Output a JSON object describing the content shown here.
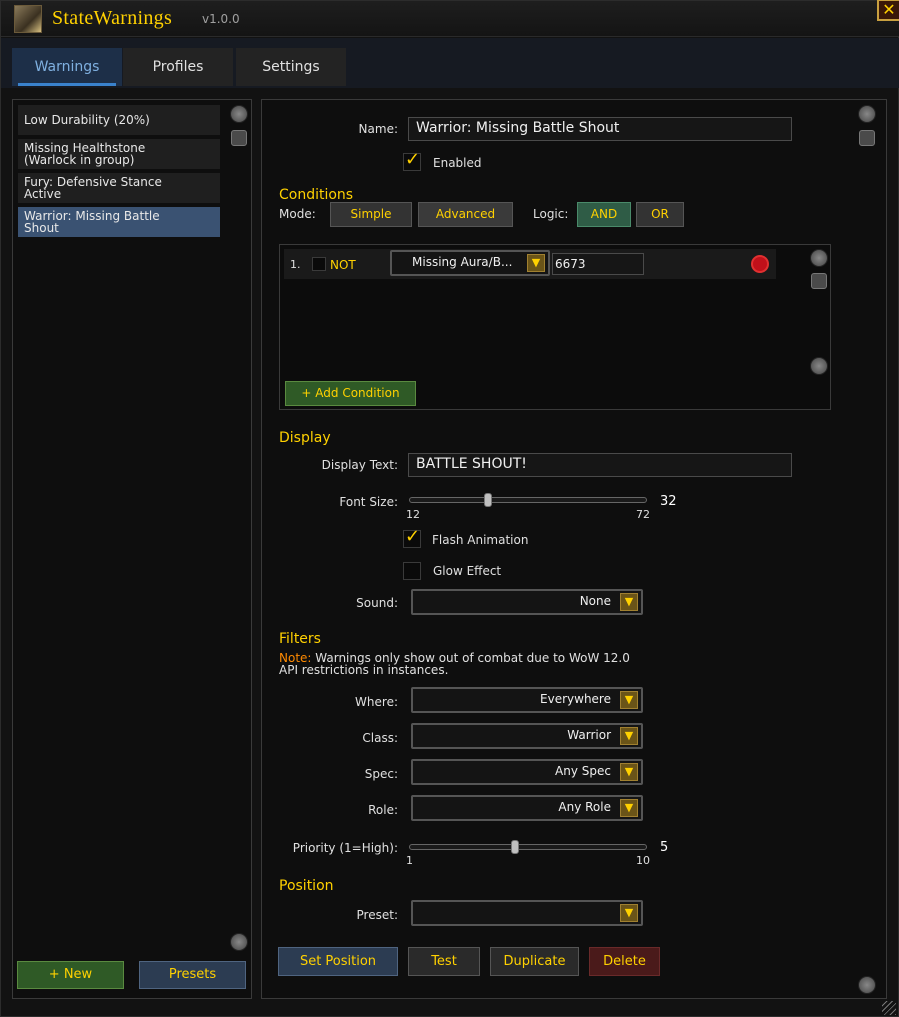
{
  "app": {
    "title": "StateWarnings",
    "version": "v1.0.0",
    "close_glyph": "✕"
  },
  "tabs": [
    "Warnings",
    "Profiles",
    "Settings"
  ],
  "warnings_list": [
    "Low Durability (20%)",
    "Missing Healthstone\n(Warlock in group)",
    "Fury: Defensive Stance\nActive",
    "Warrior: Missing Battle\nShout"
  ],
  "left_buttons": {
    "new": "+ New",
    "presets": "Presets"
  },
  "editor": {
    "name_label": "Name:",
    "name_value": "Warrior: Missing Battle Shout",
    "enabled_label": "Enabled",
    "conditions": {
      "heading": "Conditions",
      "mode_label": "Mode:",
      "mode_simple": "Simple",
      "mode_advanced": "Advanced",
      "logic_label": "Logic:",
      "logic_and": "AND",
      "logic_or": "OR",
      "row": {
        "index": "1.",
        "not_label": "NOT",
        "type": "Missing Aura/B...",
        "value": "6673"
      },
      "add_button": "+ Add Condition"
    },
    "display": {
      "heading": "Display",
      "text_label": "Display Text:",
      "text_value": "BATTLE SHOUT!",
      "font_size_label": "Font Size:",
      "font_size_value": "32",
      "font_size_min": "12",
      "font_size_max": "72",
      "font_size_fraction": 0.333,
      "flash_label": "Flash Animation",
      "glow_label": "Glow Effect",
      "sound_label": "Sound:",
      "sound_value": "None"
    },
    "filters": {
      "heading": "Filters",
      "note_prefix": "Note:",
      "note_text": " Warnings only show out of combat due to WoW 12.0 API restrictions in instances.",
      "where_label": "Where:",
      "where_value": "Everywhere",
      "class_label": "Class:",
      "class_value": "Warrior",
      "spec_label": "Spec:",
      "spec_value": "Any Spec",
      "role_label": "Role:",
      "role_value": "Any Role",
      "priority_label": "Priority (1=High):",
      "priority_value": "5",
      "priority_min": "1",
      "priority_max": "10",
      "priority_fraction": 0.444
    },
    "position": {
      "heading": "Position",
      "preset_label": "Preset:",
      "preset_value": ""
    },
    "buttons": {
      "set_position": "Set Position",
      "test": "Test",
      "duplicate": "Duplicate",
      "delete": "Delete"
    }
  }
}
